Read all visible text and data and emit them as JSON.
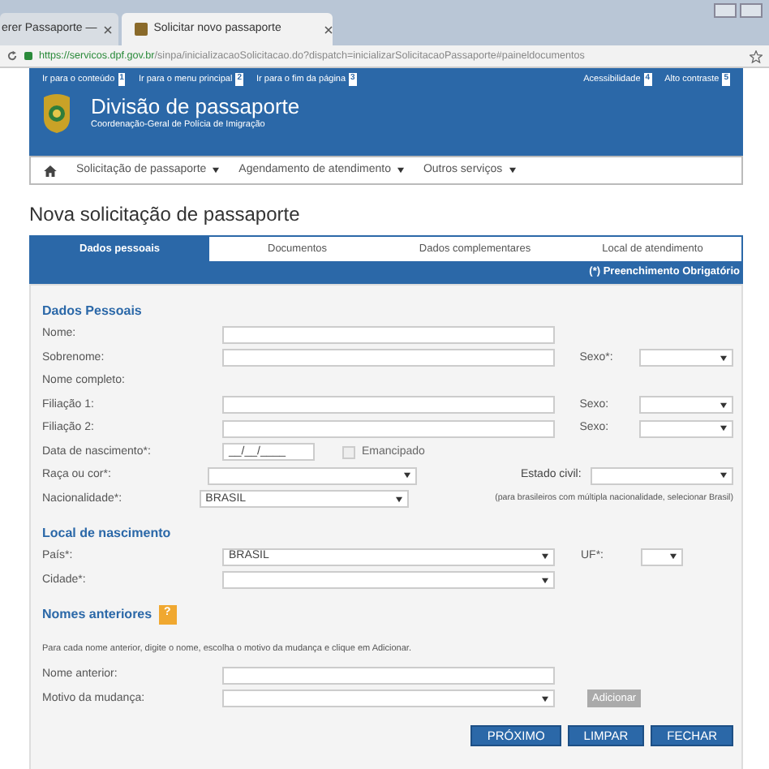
{
  "browser": {
    "tabs": [
      {
        "title": "erer Passaporte —",
        "selected": false
      },
      {
        "title": "Solicitar novo passaporte",
        "selected": true
      }
    ],
    "url_host": "https://servicos.dpf.gov.br",
    "url_path": "/sinpa/inicializacaoSolicitacao.do?dispatch=inicializarSolicitacaoPassaporte#paineldocumentos"
  },
  "header": {
    "skip_links": [
      {
        "label": "Ir para o conteúdo",
        "key": "1"
      },
      {
        "label": "Ir para o menu principal",
        "key": "2"
      },
      {
        "label": "Ir para o fim da página",
        "key": "3"
      }
    ],
    "access_links": [
      {
        "label": "Acessibilidade",
        "key": "4"
      },
      {
        "label": "Alto contraste",
        "key": "5"
      }
    ],
    "title": "Divisão de passaporte",
    "subtitle": "Coordenação-Geral de Polícia de Imigração"
  },
  "nav": {
    "items": [
      {
        "label": "Solicitação de passaporte",
        "dropdown": true
      },
      {
        "label": "Agendamento de atendimento",
        "dropdown": true
      },
      {
        "label": "Outros serviços",
        "dropdown": true
      }
    ]
  },
  "page_title": "Nova solicitação de passaporte",
  "form_tabs": [
    {
      "label": "Dados pessoais",
      "selected": true
    },
    {
      "label": "Documentos",
      "selected": false
    },
    {
      "label": "Dados complementares",
      "selected": false
    },
    {
      "label": "Local de atendimento",
      "selected": false
    }
  ],
  "required_note": "(*) Preenchimento Obrigatório",
  "sections": [
    {
      "title": "Dados Pessoais",
      "rows": [
        {
          "label": "Nome:",
          "kind": "text"
        },
        {
          "label": "Sobrenome:",
          "kind": "text",
          "right": {
            "label": "Sexo*:",
            "kind": "select"
          }
        },
        {
          "label": "Nome completo:",
          "kind": "none"
        },
        {
          "label": "Filiação 1:",
          "kind": "text",
          "right": {
            "label": "Sexo:",
            "kind": "select"
          }
        },
        {
          "label": "Filiação 2:",
          "kind": "text",
          "right": {
            "label": "Sexo:",
            "kind": "select"
          }
        },
        {
          "label": "Data de nascimento*:",
          "kind": "date",
          "value": "__/__/____",
          "checkbox": {
            "label": "Emancipado",
            "checked": false,
            "disabled": true
          }
        },
        {
          "label": "Raça ou cor*:",
          "kind": "select_short",
          "right": {
            "label": "Estado civil:",
            "kind": "select_wide"
          }
        },
        {
          "label": "Nacionalidade*:",
          "kind": "select_short",
          "value": "BRASIL",
          "note": "(para brasileiros com múltipla nacionalidade, selecionar Brasil)"
        }
      ]
    },
    {
      "title": "Local de nascimento",
      "rows": [
        {
          "label": "País*:",
          "kind": "select",
          "value": "BRASIL",
          "right": {
            "label": "UF*:",
            "kind": "select_tiny"
          }
        },
        {
          "label": "Cidade*:",
          "kind": "select"
        }
      ]
    },
    {
      "title": "Nomes anteriores",
      "help": "?",
      "instructions": "Para cada nome anterior, digite o nome, escolha o motivo da mudança e clique em Adicionar.",
      "rows": [
        {
          "label": "Nome anterior:",
          "kind": "text"
        },
        {
          "label": "Motivo da mudança:",
          "kind": "select",
          "button": {
            "label": "Adicionar",
            "disabled": true
          }
        }
      ]
    }
  ],
  "buttons": [
    "PRÓXIMO",
    "LIMPAR",
    "FECHAR"
  ]
}
